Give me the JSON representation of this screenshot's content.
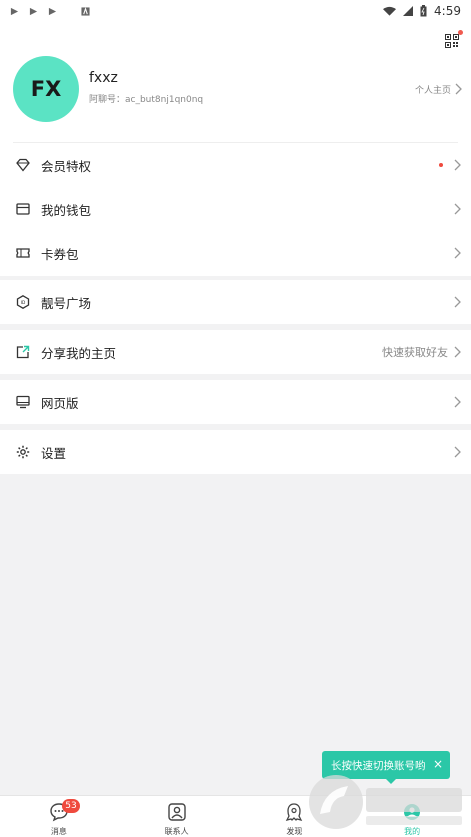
{
  "status_bar": {
    "time": "4:59"
  },
  "profile": {
    "avatar_text": "FX",
    "avatar_color": "#5be3c4",
    "username": "fxxz",
    "account_id": "阿聊号：ac_but8nj1qn0nq",
    "homepage_link": "个人主页"
  },
  "menu": {
    "group1": [
      {
        "label": "会员特权",
        "icon": "diamond-icon",
        "has_dot": true
      },
      {
        "label": "我的钱包",
        "icon": "wallet-icon"
      },
      {
        "label": "卡券包",
        "icon": "ticket-icon"
      }
    ],
    "group2": [
      {
        "label": "靓号广场",
        "icon": "hexagon-id-icon"
      }
    ],
    "group3": [
      {
        "label": "分享我的主页",
        "icon": "share-icon",
        "right_text": "快速获取好友"
      }
    ],
    "group4": [
      {
        "label": "网页版",
        "icon": "monitor-icon"
      }
    ],
    "group5": [
      {
        "label": "设置",
        "icon": "gear-icon"
      }
    ]
  },
  "tooltip": {
    "text": "长按快速切换账号哟",
    "close": "×"
  },
  "tabbar": {
    "tabs": [
      {
        "label": "消息",
        "icon": "chat-bubble-icon",
        "badge": "53"
      },
      {
        "label": "联系人",
        "icon": "contact-icon"
      },
      {
        "label": "发现",
        "icon": "discover-icon"
      },
      {
        "label": "我的",
        "icon": "me-icon"
      }
    ]
  },
  "colors": {
    "accent": "#2bc7a7",
    "badge": "#ef4a3e",
    "background": "#f2f2f3"
  }
}
